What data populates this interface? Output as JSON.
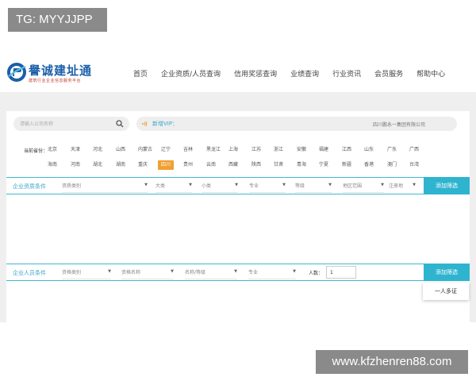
{
  "overlay": {
    "tg_badge": "TG: MYYJJPP",
    "watermark": "www.kfzhenren88.com"
  },
  "logo": {
    "name": "譽诚建址通",
    "slogan": "建筑行业企业信息服务平台",
    "icon": "logo-circle-icon"
  },
  "nav": {
    "items": [
      "首页",
      "企业资质/人员查询",
      "信用奖惩查询",
      "业绩查询",
      "行业资讯",
      "会员服务",
      "帮助中心"
    ]
  },
  "search": {
    "placeholder": "请输入公司名称",
    "icon": "search-icon"
  },
  "vip": {
    "label": "新增VIP：",
    "company": "四川鹏永一集团有限公司",
    "icon": "broadcast-icon"
  },
  "region": {
    "label": "当前省份：",
    "row1": [
      "北京",
      "天津",
      "河北",
      "山西",
      "内蒙古",
      "辽宁",
      "吉林",
      "黑龙江",
      "上海",
      "江苏",
      "浙江",
      "安徽",
      "福建",
      "江西",
      "山东",
      "广东",
      "广西"
    ],
    "row2": [
      "海南",
      "河南",
      "湖北",
      "湖南",
      "重庆",
      "四川",
      "贵州",
      "云南",
      "西藏",
      "陕西",
      "甘肃",
      "青海",
      "宁夏",
      "新疆",
      "香港",
      "澳门",
      "台湾"
    ],
    "active": "四川",
    "active_color": "#f0a030"
  },
  "company_filter": {
    "title": "企业资质条件",
    "selects": [
      "资质类别",
      "大类",
      "小类",
      "专业",
      "等级",
      "地区范围",
      "注册地"
    ],
    "button": "添加筛选"
  },
  "person_filter": {
    "title": "企业人员条件",
    "selects": [
      "资格类别",
      "资格名称",
      "名称/等级",
      "专业"
    ],
    "count_label": "人数：",
    "count_value": "1",
    "button": "添加筛选",
    "dropdown_option": "一人多证"
  },
  "colors": {
    "accent": "#2fb4cf",
    "brand": "#1a5fa8",
    "active": "#f0a030"
  }
}
